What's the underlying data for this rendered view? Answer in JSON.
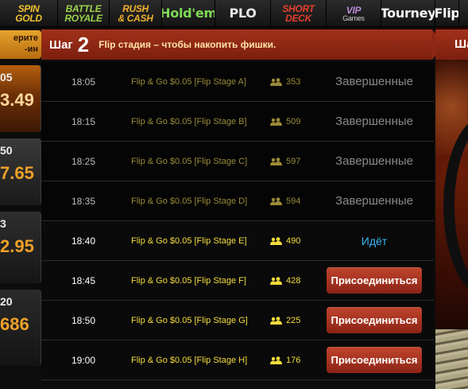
{
  "topnav": {
    "tabs": [
      {
        "id": "spin-gold",
        "line1": "SPIN",
        "line2": "GOLD",
        "color": "#f2c230",
        "width": 73
      },
      {
        "id": "battle-royale",
        "line1": "BATTLE",
        "line2": "ROYALE",
        "color": "#9bd24a",
        "width": 65
      },
      {
        "id": "rush-cash",
        "line1": "RUSH",
        "line2": "& CASH",
        "color": "#f0b030",
        "width": 66
      },
      {
        "id": "holdem",
        "line1": "Hold'em",
        "line2": "",
        "color": "#7ed957",
        "width": 67
      },
      {
        "id": "plo",
        "line1": "PLO",
        "line2": "",
        "color": "#e6e6e6",
        "width": 70
      },
      {
        "id": "short-deck",
        "line1": "SHORT",
        "line2": "DECK",
        "color": "#e5402c",
        "width": 70
      },
      {
        "id": "vip-games",
        "line1": "VIP",
        "line2": "Games",
        "color": "#b98bd8",
        "width": 69
      },
      {
        "id": "tourney",
        "line1": "Tourney",
        "line2": "",
        "color": "#f4f4f4",
        "width": 68
      },
      {
        "id": "flip",
        "line1": "Flip",
        "line2": "",
        "color": "#ffffff",
        "width": 30
      }
    ]
  },
  "left": {
    "banner_line1": "ерите",
    "banner_line2": "-ин",
    "cards": [
      {
        "time": "05",
        "value": "3.49"
      },
      {
        "time": "50",
        "value": "7.65"
      },
      {
        "time": "3",
        "value": "2.95"
      },
      {
        "time": "20",
        "value": "686"
      }
    ]
  },
  "step": {
    "label": "Шаг",
    "number": "2",
    "description": "Flip стадия – чтобы накопить фишки."
  },
  "right": {
    "tab_label": "Ша"
  },
  "rows": [
    {
      "time": "18:05",
      "name": "Flip & Go $0.05 [Flip Stage A]",
      "players": "353",
      "state": "finished",
      "status": "Завершенные"
    },
    {
      "time": "18:15",
      "name": "Flip & Go $0.05 [Flip Stage B]",
      "players": "509",
      "state": "finished",
      "status": "Завершенные"
    },
    {
      "time": "18:25",
      "name": "Flip & Go $0.05 [Flip Stage C]",
      "players": "597",
      "state": "finished",
      "status": "Завершенные"
    },
    {
      "time": "18:35",
      "name": "Flip & Go $0.05 [Flip Stage D]",
      "players": "594",
      "state": "finished",
      "status": "Завершенные"
    },
    {
      "time": "18:40",
      "name": "Flip & Go $0.05 [Flip Stage E]",
      "players": "490",
      "state": "running",
      "status": "Идёт"
    },
    {
      "time": "18:45",
      "name": "Flip & Go $0.05 [Flip Stage F]",
      "players": "428",
      "state": "join",
      "status": "Присоединиться"
    },
    {
      "time": "18:50",
      "name": "Flip & Go $0.05 [Flip Stage G]",
      "players": "225",
      "state": "join",
      "status": "Присоединиться"
    },
    {
      "time": "19:00",
      "name": "Flip & Go $0.05 [Flip Stage H]",
      "players": "176",
      "state": "join",
      "status": "Присоединиться"
    }
  ],
  "colors": {
    "accent_red": "#a2311a",
    "running_blue": "#39b6f2",
    "active_yellow": "#f3dc3c",
    "dim_yellow": "#9a8a38"
  }
}
